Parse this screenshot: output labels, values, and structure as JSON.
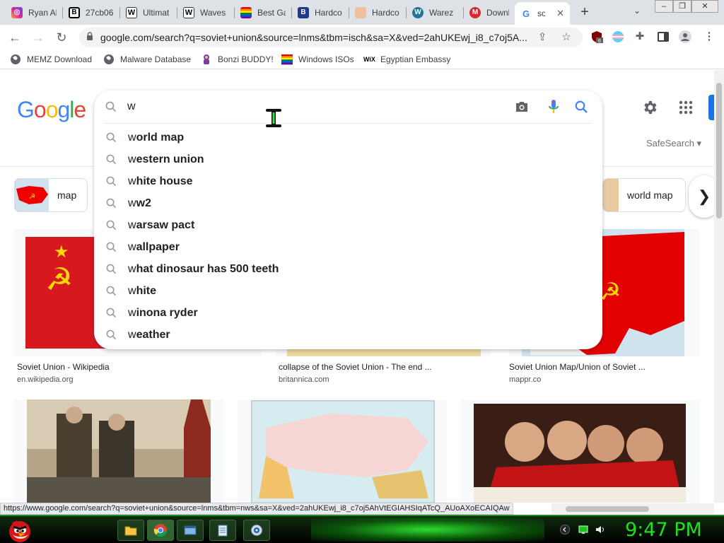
{
  "tabs": [
    {
      "label": "Ryan Al",
      "icon": "instagram-icon"
    },
    {
      "label": "27cb06",
      "icon": "b-square-icon"
    },
    {
      "label": "Ultimat",
      "icon": "wikipedia-w-icon"
    },
    {
      "label": "Waves",
      "icon": "wikipedia-w-icon"
    },
    {
      "label": "Best Ga",
      "icon": "rainbow-flag-icon"
    },
    {
      "label": "Hardco",
      "icon": "b-box-icon"
    },
    {
      "label": "Hardco",
      "icon": "hands-icon"
    },
    {
      "label": "Warez",
      "icon": "wordpress-icon"
    },
    {
      "label": "Downlo",
      "icon": "mega-icon"
    },
    {
      "label": "sov",
      "icon": "google-g-icon"
    }
  ],
  "address": {
    "url": "google.com/search?q=soviet+union&source=lnms&tbm=isch&sa=X&ved=2ahUKEwj_i8_c7oj5A..."
  },
  "extension_badge": "6",
  "bookmarks": [
    {
      "label": "MEMZ Download"
    },
    {
      "label": "Malware Database"
    },
    {
      "label": "Bonzi BUDDY!"
    },
    {
      "label": "Windows ISOs"
    },
    {
      "label": "Egyptian Embassy"
    }
  ],
  "search": {
    "query": "w",
    "suggestions": [
      {
        "prefix": "w",
        "rest": "orld map"
      },
      {
        "prefix": "w",
        "rest": "estern union"
      },
      {
        "prefix": "w",
        "rest": "hite house"
      },
      {
        "prefix": "w",
        "rest": "w2"
      },
      {
        "prefix": "w",
        "rest": "arsaw pact"
      },
      {
        "prefix": "w",
        "rest": "allpaper"
      },
      {
        "prefix": "w",
        "rest": "hat dinosaur has 500 teeth"
      },
      {
        "prefix": "w",
        "rest": "hite"
      },
      {
        "prefix": "w",
        "rest": "inona ryder"
      },
      {
        "prefix": "w",
        "rest": "eather"
      }
    ]
  },
  "safesearch_label": "SafeSearch",
  "chips": [
    {
      "label": "map"
    },
    {
      "label": "world map"
    }
  ],
  "results": [
    {
      "title": "Soviet Union - Wikipedia",
      "source": "en.wikipedia.org"
    },
    {
      "title": "collapse of the Soviet Union - The end ...",
      "source": "britannica.com"
    },
    {
      "title": "Soviet Union Map/Union of Soviet ...",
      "source": "mappr.co"
    }
  ],
  "status_url": "https://www.google.com/search?q=soviet+union&source=lnms&tbm=nws&sa=X&ved=2ahUKEwj_i8_c7oj5AhVtEGIAHSIqATcQ_AUoAXoECAIQAw",
  "clock": "9:47 PM",
  "colors": {
    "google_blue": "#4285F4",
    "google_red": "#EA4335",
    "google_yellow": "#FBBC05",
    "google_green": "#34A853",
    "clock_green": "#22dd22"
  }
}
